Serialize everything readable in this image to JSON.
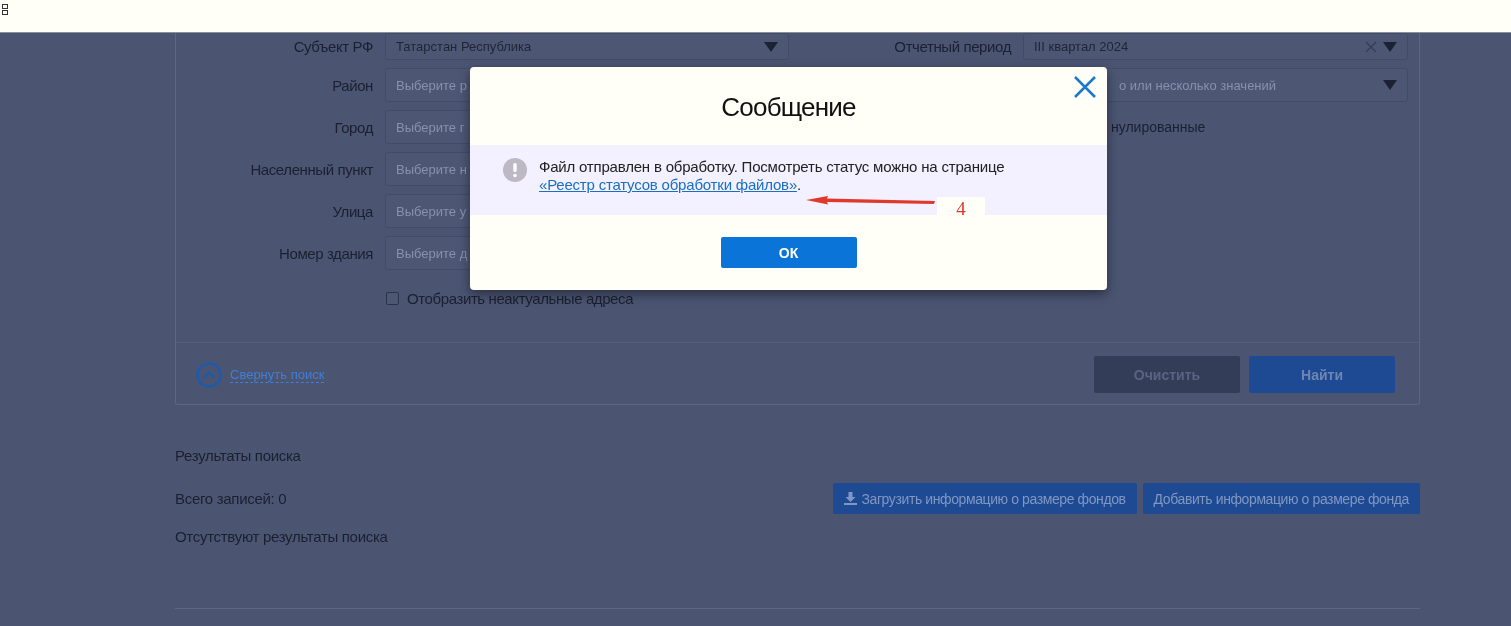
{
  "search": {
    "left_fields": [
      {
        "label": "Субъект РФ",
        "text": "Татарстан Республика",
        "kind": "value"
      },
      {
        "label": "Район",
        "text": "Выберите р",
        "kind": "placeholder"
      },
      {
        "label": "Город",
        "text": "Выберите г",
        "kind": "placeholder"
      },
      {
        "label": "Населенный пункт",
        "text": "Выберите н",
        "kind": "placeholder"
      },
      {
        "label": "Улица",
        "text": "Выберите у",
        "kind": "placeholder"
      },
      {
        "label": "Номер здания",
        "text": "Выберите д",
        "kind": "placeholder"
      }
    ],
    "right_fields": [
      {
        "label": "Отчетный период",
        "text": "III квартал 2024",
        "kind": "value"
      },
      {
        "text": "о или несколько значений",
        "kind": "placeholder"
      }
    ],
    "partial_label": "нулированные",
    "checkbox": {
      "label": "Отобразить неактуальные адреса",
      "checked": false
    },
    "collapse_link": "Свернуть поиск",
    "buttons": [
      {
        "label": "Очистить",
        "kind": "secondary"
      },
      {
        "label": "Найти",
        "kind": "primary"
      }
    ]
  },
  "results": {
    "title": "Результаты поиска",
    "count": "Всего записей: 0",
    "empty": "Отсутствуют результаты поиска",
    "buttons": [
      {
        "label": "Загрузить информацию о размере фондов",
        "kind": "upload"
      },
      {
        "label": "Добавить информацию о размере фонда",
        "kind": "plain"
      }
    ]
  },
  "dialog": {
    "title": "Сообщение",
    "message": "Файл отправлен в обработку. Посмотреть статус можно на странице",
    "link": "«Реестр статусов обработки файлов»",
    "after_link": ".",
    "ok": "ОК"
  },
  "annotation": {
    "label": "4"
  }
}
